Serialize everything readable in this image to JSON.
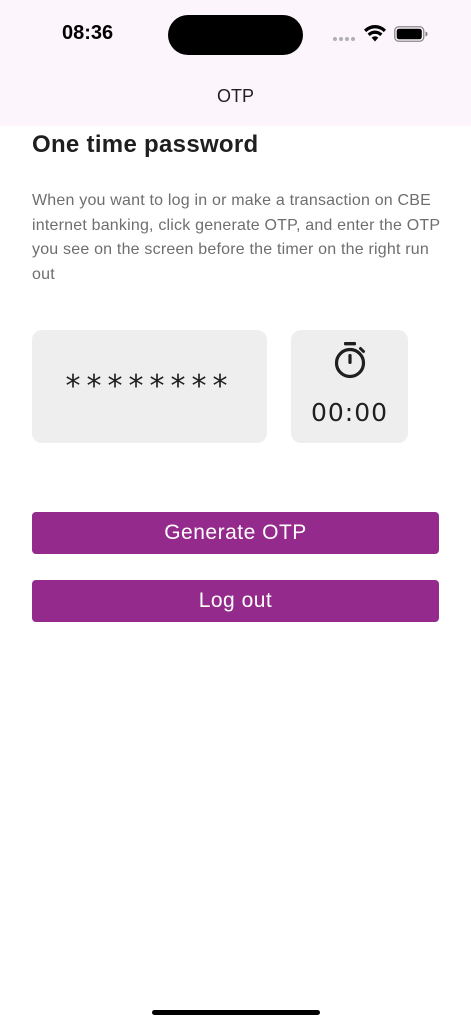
{
  "status_bar": {
    "time": "08:36",
    "icons": [
      "signal-icon",
      "wifi-icon",
      "battery-icon"
    ]
  },
  "app_bar": {
    "title": "OTP"
  },
  "main": {
    "heading": "One time password",
    "description": "When you want to log in or make a transaction on CBE internet banking, click generate OTP, and enter the OTP you see on the screen before the timer on the right run out",
    "otp_display": "********",
    "timer": {
      "icon": "stopwatch-icon",
      "value": "00:00"
    },
    "buttons": {
      "generate_label": "Generate OTP",
      "logout_label": "Log out"
    }
  },
  "colors": {
    "accent": "#952a8d",
    "topbar_bg": "#fdf5fc",
    "card_bg": "#eeeeee",
    "description_text": "#6e6e6e"
  }
}
